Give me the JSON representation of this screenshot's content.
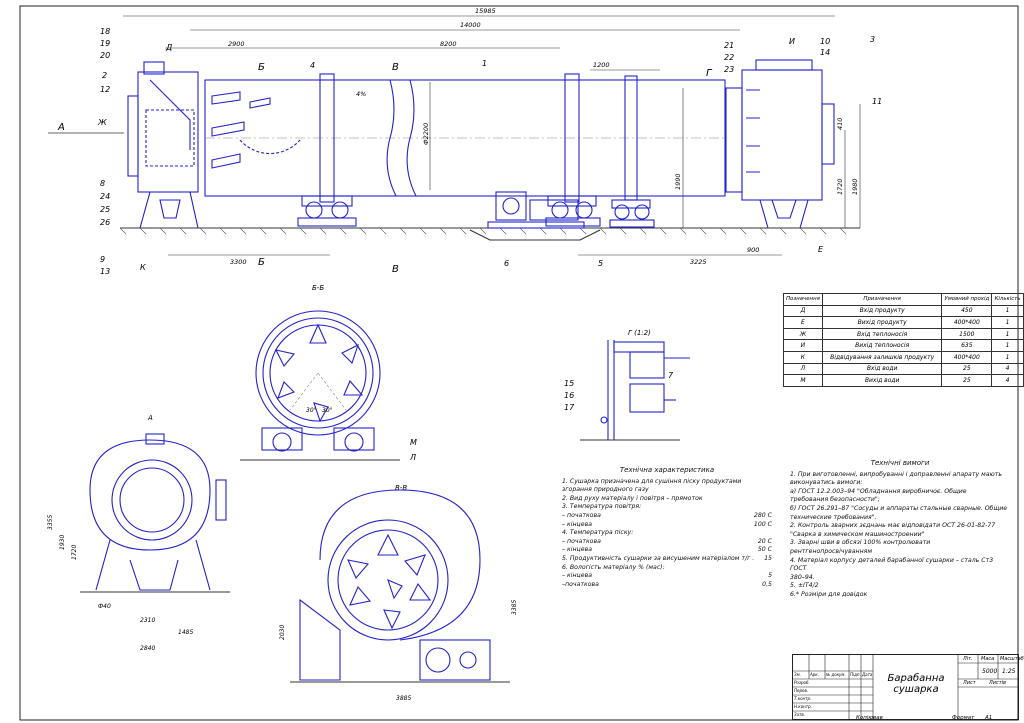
{
  "sheet": {
    "dims": {
      "overall_length": "15985",
      "shell_length": "14000",
      "left_offset": "2900",
      "mid_span": "8200",
      "right_tire": "1200",
      "left_bottom": "3300",
      "right_bottom": "3225",
      "end_900": "900",
      "diameter": "Ф2200",
      "height_1720": "1720",
      "height_1990": "1990",
      "height_1980": "1980",
      "dim_410": "410",
      "angle": "4%",
      "a_3355": "3355",
      "a_1930": "1930",
      "a_1720": "1720",
      "a_2310": "2310",
      "a_1485": "1485",
      "a_2840": "2840",
      "a_hole": "Ф40",
      "b_3385": "3385",
      "b_2030": "2030",
      "b_3885": "3885",
      "angle_30a": "30°",
      "angle_30b": "30°"
    },
    "labels": {
      "view_A": "А",
      "section_BB": "Б-Б",
      "section_VV": "В-В",
      "view_A_small": "А",
      "detail_G": "Г (1:2)",
      "cut_B_top": "Б",
      "cut_B_bot": "Б",
      "cut_V_top": "В",
      "cut_V_bot": "В",
      "cut_G": "Г",
      "letter_D": "Д",
      "letter_Zh": "Ж",
      "letter_K": "К",
      "letter_E": "Е",
      "letter_I": "И",
      "letter_M": "М",
      "letter_L": "Л"
    },
    "positions": [
      "1",
      "2",
      "3",
      "4",
      "5",
      "6",
      "7",
      "8",
      "9",
      "10",
      "11",
      "12",
      "13",
      "14",
      "15",
      "16",
      "17",
      "18",
      "19",
      "20",
      "21",
      "22",
      "23",
      "24",
      "25",
      "26"
    ]
  },
  "table": {
    "headers": [
      "Позначення",
      "Призначення",
      "Умовний прохід",
      "Кількість"
    ],
    "rows": [
      [
        "Д",
        "Вхід продукту",
        "450",
        "1"
      ],
      [
        "Е",
        "Вихід продукту",
        "400*400",
        "1"
      ],
      [
        "Ж",
        "Вхід теплоносія",
        "1500",
        "1"
      ],
      [
        "И",
        "Вихід теплоносія",
        "635",
        "1"
      ],
      [
        "К",
        "Відвідування залишків продукту",
        "400*400",
        "1"
      ],
      [
        "Л",
        "Вхід води",
        "25",
        "4"
      ],
      [
        "М",
        "Вихід води",
        "25",
        "4"
      ]
    ]
  },
  "tech_char": {
    "title": "Технічна характеристика",
    "lines": [
      {
        "text": "1. Сушарка призначена для сушіння піску продуктами згорання природного газу",
        "value": ""
      },
      {
        "text": "2. Вид руху матеріалу і повітря – прямоток",
        "value": ""
      },
      {
        "text": "3. Температура повітря:",
        "value": ""
      },
      {
        "text": "   – початкова",
        "value": "280 С"
      },
      {
        "text": "   – кінцева",
        "value": "100 С"
      },
      {
        "text": "4. Температура піску:",
        "value": ""
      },
      {
        "text": "   – початкова",
        "value": "20 С"
      },
      {
        "text": "   – кінцева",
        "value": "50 С"
      },
      {
        "text": "5. Продуктивність сушарки за висушеним матеріалом т/г .",
        "value": "15"
      },
      {
        "text": "6. Вологість матеріалу % (мас):",
        "value": ""
      },
      {
        "text": "   – кінцева",
        "value": "5"
      },
      {
        "text": "   –початкова",
        "value": "0,5"
      }
    ]
  },
  "tech_req": {
    "title": "Технічні вимоги",
    "lines": [
      "1. При виготовленні, випробуванні і доправленні апарату мають виконуватись вимоги:",
      "   а) ГОСТ 12.2.003–94 \"Обладнання виробничоє. Общие",
      "требования безопасности\";",
      "   б) ГОСТ 26.291–87 \"Сосуды и аппараты стальные сварные. Общие",
      "технические требования\".",
      "2. Контроль зварних зєднань має відповідати ОСТ 26-01-82-77",
      "   \"Сварка в химическом машиностроении\"",
      "3. Зварні шви в обсязі 100% контролювати",
      "   рентгенопросвічуванням",
      "4. Матеріал корпусу деталей барабанної сушарки – сталь Ст3 ГОСТ",
      "   380–94.",
      "5. ±IT4/2",
      "6.* Розміри для довідок"
    ]
  },
  "stamp": {
    "title_line1": "Барабанна",
    "title_line2": "сушарка",
    "litera": "Літ.",
    "mass": "Маса",
    "scale": "Масштаб",
    "mass_value": "5000",
    "scale_value": "1:25",
    "sheet": "Лист",
    "sheets": "Листів",
    "rows": [
      "Зм.",
      "Арк.",
      "№ докум.",
      "Підп.",
      "Дата",
      "Розроб.",
      "Перев.",
      "Т.контр.",
      "Н.контр.",
      "Затв."
    ]
  },
  "footer": {
    "copied": "Копіював",
    "format": "Формат",
    "format_value": "А1"
  }
}
